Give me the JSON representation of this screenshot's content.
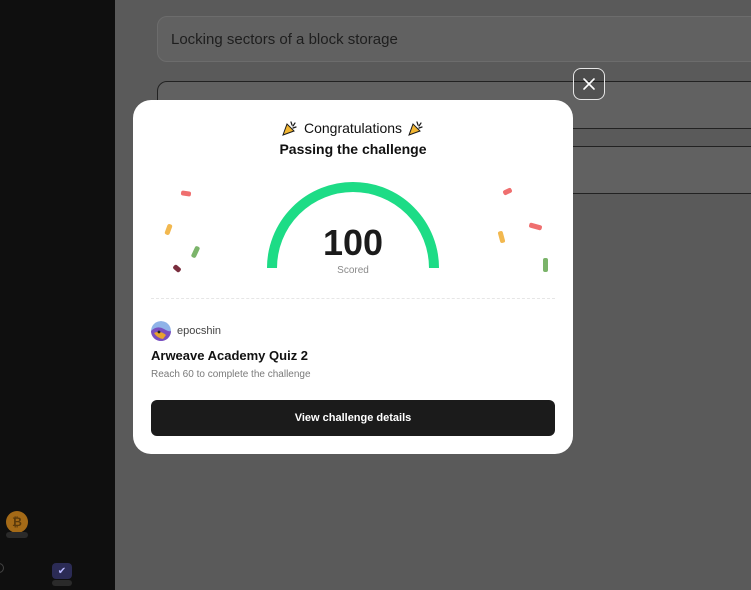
{
  "background": {
    "options": [
      {
        "label": "Locking sectors of a block storage"
      },
      {
        "label": ""
      },
      {
        "label": ""
      }
    ],
    "sidebar_icons": [
      "bitcoin-icon",
      "badge-icon"
    ]
  },
  "modal": {
    "title": "Congratulations",
    "subtitle": "Passing the challenge",
    "score": "100",
    "score_label": "Scored",
    "score_fraction": 1.0,
    "accent_color": "#1ddc86",
    "user": {
      "name": "epocshin"
    },
    "quiz_title": "Arweave Academy Quiz 2",
    "quiz_requirement": "Reach 60 to complete the challenge",
    "cta_label": "View challenge details"
  },
  "icons": [
    "party-popper-icon",
    "close-icon",
    "avatar"
  ]
}
